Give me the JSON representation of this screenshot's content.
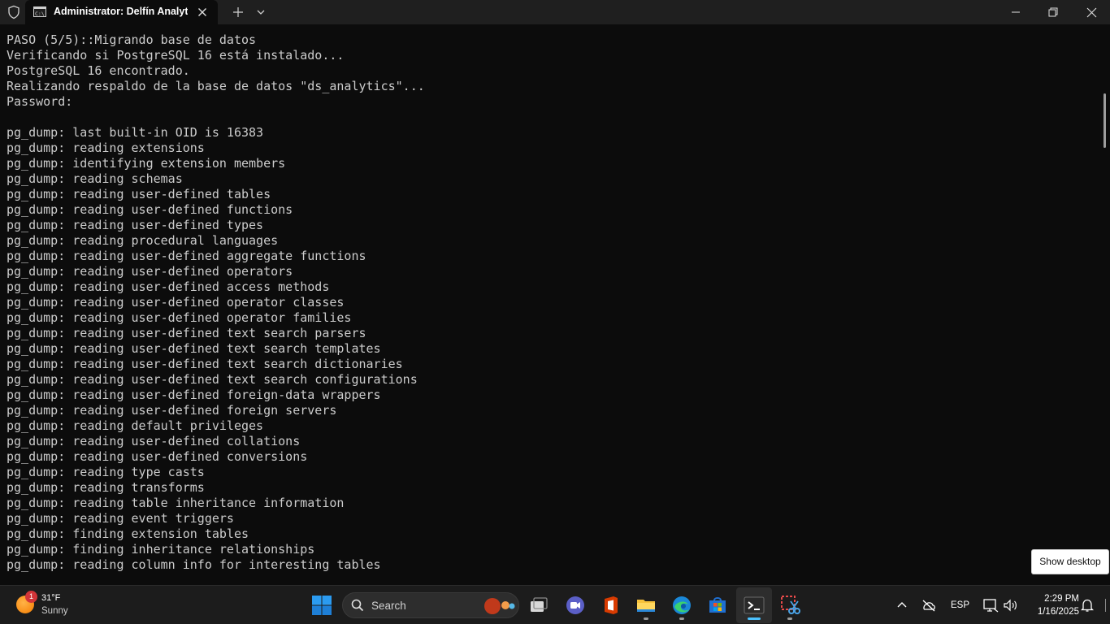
{
  "window": {
    "tab_title": "Administrator:  Delfín Analytics"
  },
  "terminal": {
    "lines": [
      "PASO (5/5)::Migrando base de datos",
      "Verificando si PostgreSQL 16 está instalado...",
      "PostgreSQL 16 encontrado.",
      "Realizando respaldo de la base de datos \"ds_analytics\"...",
      "Password:",
      "",
      "pg_dump: last built-in OID is 16383",
      "pg_dump: reading extensions",
      "pg_dump: identifying extension members",
      "pg_dump: reading schemas",
      "pg_dump: reading user-defined tables",
      "pg_dump: reading user-defined functions",
      "pg_dump: reading user-defined types",
      "pg_dump: reading procedural languages",
      "pg_dump: reading user-defined aggregate functions",
      "pg_dump: reading user-defined operators",
      "pg_dump: reading user-defined access methods",
      "pg_dump: reading user-defined operator classes",
      "pg_dump: reading user-defined operator families",
      "pg_dump: reading user-defined text search parsers",
      "pg_dump: reading user-defined text search templates",
      "pg_dump: reading user-defined text search dictionaries",
      "pg_dump: reading user-defined text search configurations",
      "pg_dump: reading user-defined foreign-data wrappers",
      "pg_dump: reading user-defined foreign servers",
      "pg_dump: reading default privileges",
      "pg_dump: reading user-defined collations",
      "pg_dump: reading user-defined conversions",
      "pg_dump: reading type casts",
      "pg_dump: reading transforms",
      "pg_dump: reading table inheritance information",
      "pg_dump: reading event triggers",
      "pg_dump: finding extension tables",
      "pg_dump: finding inheritance relationships",
      "pg_dump: reading column info for interesting tables"
    ]
  },
  "taskbar": {
    "weather": {
      "temp": "31°F",
      "condition": "Sunny",
      "badge": "1"
    },
    "search_label": "Search",
    "apps": [
      "task-view",
      "teams-meet",
      "office",
      "file-explorer",
      "edge",
      "microsoft-store",
      "terminal",
      "snipping-tool"
    ],
    "tray": {
      "language": "ESP",
      "time": "2:29 PM",
      "date": "1/16/2025"
    }
  },
  "tooltip": {
    "label": "Show desktop"
  },
  "colors": {
    "accent": "#4cc2ff",
    "terminal_bg": "#0c0c0c",
    "terminal_fg": "#cccccc"
  }
}
